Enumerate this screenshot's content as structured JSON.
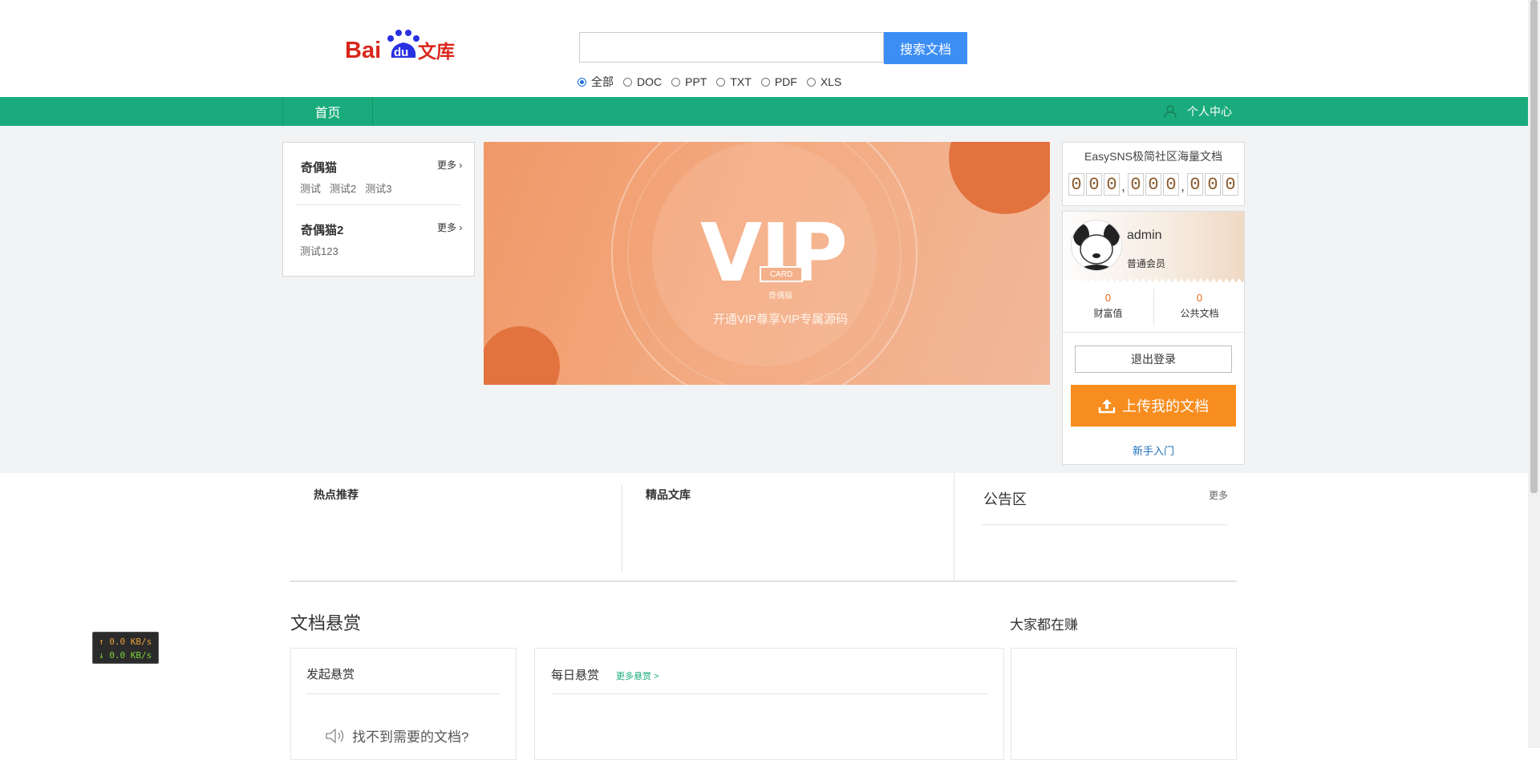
{
  "header": {
    "logo_alt": "Baidu文库",
    "search": {
      "placeholder": "",
      "button_label": "搜索文档"
    },
    "file_types": [
      {
        "label": "全部",
        "selected": true
      },
      {
        "label": "DOC",
        "selected": false
      },
      {
        "label": "PPT",
        "selected": false
      },
      {
        "label": "TXT",
        "selected": false
      },
      {
        "label": "PDF",
        "selected": false
      },
      {
        "label": "XLS",
        "selected": false
      }
    ]
  },
  "nav": {
    "home_label": "首页",
    "user_center_label": "个人中心"
  },
  "categories": [
    {
      "title": "奇偶猫",
      "more": "更多",
      "links": [
        "测试",
        "测试2",
        "测试3"
      ]
    },
    {
      "title": "奇偶猫2",
      "more": "更多",
      "links": [
        "测试123"
      ]
    }
  ],
  "banner": {
    "vip": "VIP",
    "card": "CARD",
    "small": "奇偶猫",
    "subtitle": "开通VIP尊享VIP专属源码"
  },
  "counter": {
    "title": "EasySNS极简社区海量文档",
    "digits": [
      "0",
      "0",
      "0",
      "0",
      "0",
      "0",
      "0",
      "0",
      "0"
    ]
  },
  "user": {
    "name": "admin",
    "role": "普通会员",
    "stats": [
      {
        "value": "0",
        "label": "财富值"
      },
      {
        "value": "0",
        "label": "公共文档"
      }
    ],
    "logout_label": "退出登录",
    "upload_label": "上传我的文档",
    "newbie_label": "新手入门"
  },
  "lower": {
    "hot_title": "热点推荐",
    "premium_title": "精品文库",
    "notice_title": "公告区",
    "notice_more": "更多"
  },
  "reward": {
    "title": "文档悬赏",
    "launch_title": "发起悬赏",
    "daily_title": "每日悬赏",
    "daily_more": "更多悬赏 >",
    "cant_find": "找不到需要的文档?",
    "earn_title": "大家都在赚"
  },
  "speed_widget": {
    "up": "↑ 0.0 KB/s",
    "down": "↓ 0.0 KB/s"
  },
  "colors": {
    "nav_green": "#1aab7c",
    "search_blue": "#3c8ef5",
    "upload_orange": "#f78d1e",
    "stat_orange": "#e86a1a"
  }
}
